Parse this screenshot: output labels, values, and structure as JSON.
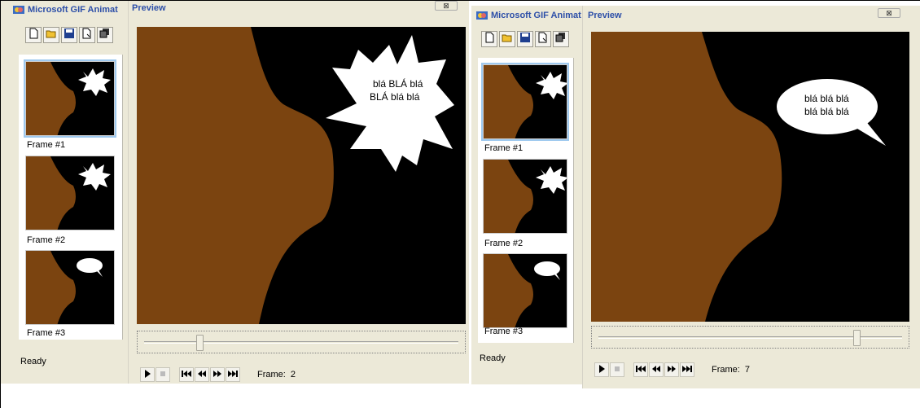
{
  "left": {
    "app_title": "Microsoft GIF Animat",
    "preview_title": "Preview",
    "close_glyph": "⊠",
    "toolbar": [
      "new-icon",
      "open-icon",
      "save-icon",
      "save-as-icon",
      "copy-frames-icon"
    ],
    "frames": [
      {
        "label": "Frame #1",
        "bubble": "star"
      },
      {
        "label": "Frame #2",
        "bubble": "star"
      },
      {
        "label": "Frame #3",
        "bubble": "oval"
      }
    ],
    "status": "Ready",
    "bubble_lines": [
      "blá BLÁ blá",
      "BLÁ blá blá"
    ],
    "frame_label": "Frame:",
    "frame_value": "2",
    "slider_position": 0.17
  },
  "right": {
    "app_title": "Microsoft GIF Animat",
    "preview_title": "Preview",
    "close_glyph": "⊠",
    "toolbar": [
      "new-icon",
      "open-icon",
      "save-icon",
      "save-as-icon",
      "copy-frames-icon"
    ],
    "frames": [
      {
        "label": "Frame #1",
        "bubble": "star"
      },
      {
        "label": "Frame #2",
        "bubble": "star"
      },
      {
        "label": "Frame #3",
        "bubble": "oval"
      }
    ],
    "status": "Ready",
    "bubble_lines": [
      "blá blá blá",
      "blá blá blá"
    ],
    "frame_label": "Frame:",
    "frame_value": "7",
    "slider_position": 0.86
  },
  "colors": {
    "brown": "#7b4410",
    "black": "#000000",
    "title_blue": "#2d4fa8",
    "panel": "#ece9d8"
  }
}
